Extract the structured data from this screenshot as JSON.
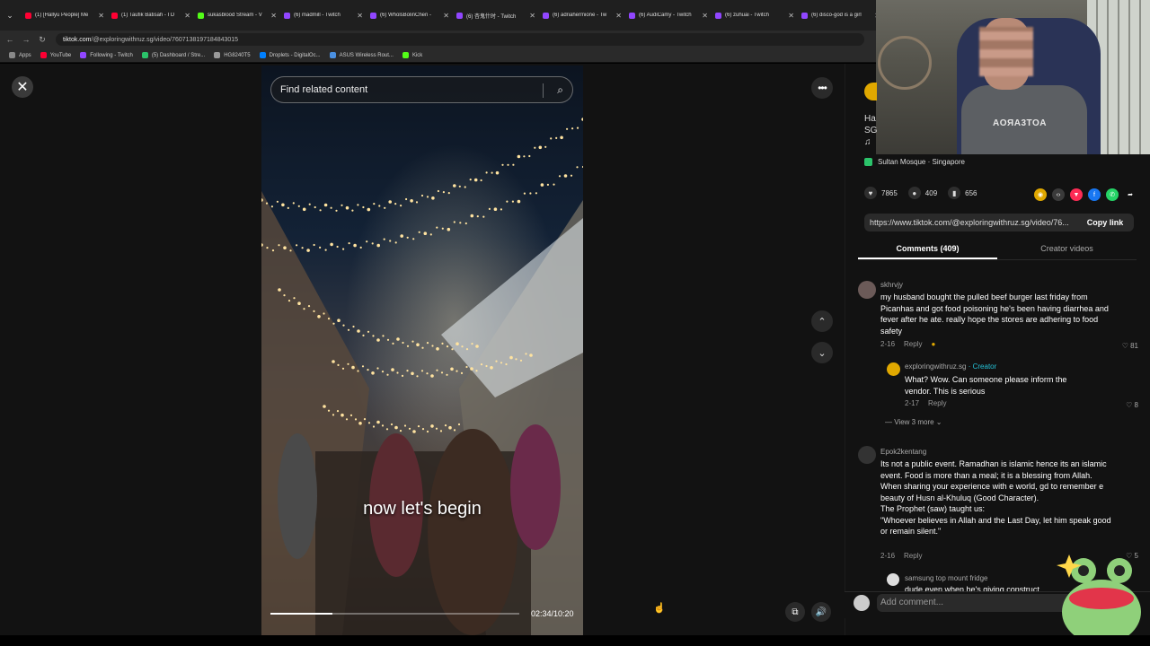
{
  "browser": {
    "tabs": [
      {
        "title": "(1) [Hallyu People] Me",
        "color": "#ff0033"
      },
      {
        "title": "(1) Taufik Batisah - I D",
        "color": "#ff0033"
      },
      {
        "title": "sukasblood Stream - V",
        "color": "#53fc18"
      },
      {
        "title": "(6) madmill - Twitch",
        "color": "#9146ff"
      },
      {
        "title": "(6) WholsBolinChen -",
        "color": "#9146ff"
      },
      {
        "title": "(6) 杏鬼什时 - Twitch",
        "color": "#9146ff"
      },
      {
        "title": "(6) adriahermione - Tw",
        "color": "#9146ff"
      },
      {
        "title": "(6) AudiCamy - Twitch",
        "color": "#9146ff"
      },
      {
        "title": "(6) zuhuai - Twitch",
        "color": "#9146ff"
      },
      {
        "title": "(6) disco-god is a girl",
        "color": "#9146ff"
      }
    ],
    "url_host": "tiktok.com",
    "url_path": "/@exploringwithruz.sg/video/7607138197184843015",
    "bookmarks": [
      {
        "label": "Apps",
        "color": "#888888"
      },
      {
        "label": "YouTube",
        "color": "#ff0033"
      },
      {
        "label": "Following - Twitch",
        "color": "#9146ff"
      },
      {
        "label": "(5) Dashboard / Stre...",
        "color": "#2bc36a"
      },
      {
        "label": "HG8240T5",
        "color": "#999999"
      },
      {
        "label": "Droplets - DigitalOc...",
        "color": "#0080ff"
      },
      {
        "label": "ASUS Wireless Rout...",
        "color": "#4a90e2"
      },
      {
        "label": "Kick",
        "color": "#53fc18"
      }
    ]
  },
  "video": {
    "search_placeholder": "Find related content",
    "caption": "now let's begin",
    "time": "02:34/10:20",
    "progress": 0.25
  },
  "panel": {
    "title_fragment_1": "Ha",
    "title_fragment_2": "SG",
    "music_note": "♫",
    "location": "Sultan Mosque · Singapore",
    "likes": "7865",
    "comments": "409",
    "saves": "656",
    "link": "https://www.tiktok.com/@exploringwithruz.sg/video/76...",
    "copy_label": "Copy link",
    "tab_comments": "Comments (409)",
    "tab_creator": "Creator videos"
  },
  "comments": [
    {
      "user": "skhrvjy",
      "text": "my husband bought the pulled beef burger last friday from Picanhas and got food poisoning he's been having diarrhea and fever after he ate. really hope the stores are adhering to food safety",
      "date": "2-16",
      "reply": "Reply",
      "likes": "81"
    },
    {
      "user": "exploringwithruz.sg",
      "creator": "· Creator",
      "text": "What? Wow. Can someone please inform the vendor. This is serious",
      "date": "2-17",
      "reply": "Reply",
      "likes": "8"
    },
    {
      "user": "Epok2kentang",
      "text": "Its not a public event. Ramadhan is islamic hence its an islamic event. Food is more than a meal; it is a blessing from Allah. When sharing your experience with e world, gd to remember e beauty of Husn al-Khuluq (Good Character).\nThe Prophet (saw) taught us:\n\"Whoever believes in Allah and the Last Day, let him speak good or remain silent.\"",
      "date": "2-16",
      "reply": "Reply",
      "likes": "5"
    },
    {
      "user": "samsung top mount fridge",
      "text": "dude even when he's giving construct"
    }
  ],
  "view_more": "View 3 more",
  "add_comment_placeholder": "Add comment...",
  "webcam_shirt_text": "AOЯA3TOA"
}
